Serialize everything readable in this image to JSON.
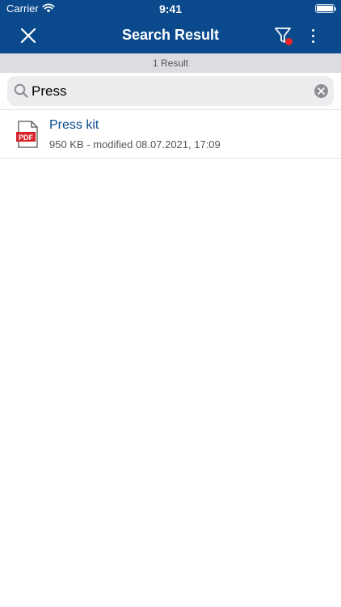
{
  "status_bar": {
    "carrier": "Carrier",
    "time": "9:41"
  },
  "navbar": {
    "title": "Search Result",
    "filter_active": true
  },
  "result_count": "1 Result",
  "search": {
    "value": "Press",
    "placeholder": ""
  },
  "results": [
    {
      "title": "Press kit",
      "file_type": "PDF",
      "meta": "950 KB - modified 08.07.2021, 17:09"
    }
  ],
  "colors": {
    "primary": "#0a4a8c",
    "badge": "#e8262a",
    "pdf_red": "#d8232a"
  }
}
